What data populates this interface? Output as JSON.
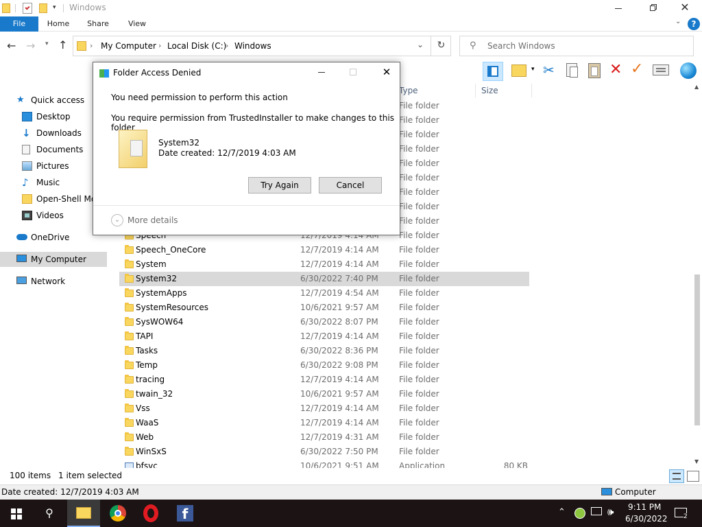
{
  "window": {
    "title": "Windows"
  },
  "ribbon": {
    "tabs": [
      "File",
      "Home",
      "Share",
      "View"
    ],
    "help": "?"
  },
  "address": {
    "crumbs": [
      "My Computer",
      "Local Disk (C:)",
      "Windows"
    ],
    "search_placeholder": "Search Windows"
  },
  "nav": {
    "items": [
      {
        "label": "Quick access",
        "icon": "star-icon",
        "top": true
      },
      {
        "label": "Desktop",
        "icon": "desktop-icon"
      },
      {
        "label": "Downloads",
        "icon": "download-icon"
      },
      {
        "label": "Documents",
        "icon": "documents-icon"
      },
      {
        "label": "Pictures",
        "icon": "pictures-icon"
      },
      {
        "label": "Music",
        "icon": "music-icon"
      },
      {
        "label": "Open-Shell Mo",
        "icon": "folder-icon"
      },
      {
        "label": "Videos",
        "icon": "videos-icon"
      },
      {
        "label": "OneDrive",
        "icon": "cloud-icon",
        "top": true
      },
      {
        "label": "My Computer",
        "icon": "computer-icon",
        "top": true,
        "selected": true
      },
      {
        "label": "Network",
        "icon": "network-icon",
        "top": true
      }
    ]
  },
  "columns": {
    "type": "Type",
    "size": "Size"
  },
  "files": [
    {
      "name": "",
      "date": "",
      "type": "File folder",
      "size": ""
    },
    {
      "name": "",
      "date": "",
      "type": "File folder",
      "size": ""
    },
    {
      "name": "",
      "date": "",
      "type": "File folder",
      "size": ""
    },
    {
      "name": "",
      "date": "",
      "type": "File folder",
      "size": ""
    },
    {
      "name": "",
      "date": "",
      "type": "File folder",
      "size": ""
    },
    {
      "name": "",
      "date": "",
      "type": "File folder",
      "size": ""
    },
    {
      "name": "",
      "date": "",
      "type": "File folder",
      "size": ""
    },
    {
      "name": "",
      "date": "",
      "type": "File folder",
      "size": ""
    },
    {
      "name": "",
      "date": "",
      "type": "File folder",
      "size": ""
    },
    {
      "name": "Speech",
      "date": "12/7/2019 4:14 AM",
      "type": "File folder",
      "size": ""
    },
    {
      "name": "Speech_OneCore",
      "date": "12/7/2019 4:14 AM",
      "type": "File folder",
      "size": ""
    },
    {
      "name": "System",
      "date": "12/7/2019 4:14 AM",
      "type": "File folder",
      "size": ""
    },
    {
      "name": "System32",
      "date": "6/30/2022 7:40 PM",
      "type": "File folder",
      "size": "",
      "selected": true
    },
    {
      "name": "SystemApps",
      "date": "12/7/2019 4:54 AM",
      "type": "File folder",
      "size": ""
    },
    {
      "name": "SystemResources",
      "date": "10/6/2021 9:57 AM",
      "type": "File folder",
      "size": ""
    },
    {
      "name": "SysWOW64",
      "date": "6/30/2022 8:07 PM",
      "type": "File folder",
      "size": ""
    },
    {
      "name": "TAPI",
      "date": "12/7/2019 4:14 AM",
      "type": "File folder",
      "size": ""
    },
    {
      "name": "Tasks",
      "date": "6/30/2022 8:36 PM",
      "type": "File folder",
      "size": ""
    },
    {
      "name": "Temp",
      "date": "6/30/2022 9:08 PM",
      "type": "File folder",
      "size": ""
    },
    {
      "name": "tracing",
      "date": "12/7/2019 4:14 AM",
      "type": "File folder",
      "size": ""
    },
    {
      "name": "twain_32",
      "date": "10/6/2021 9:57 AM",
      "type": "File folder",
      "size": ""
    },
    {
      "name": "Vss",
      "date": "12/7/2019 4:14 AM",
      "type": "File folder",
      "size": ""
    },
    {
      "name": "WaaS",
      "date": "12/7/2019 4:14 AM",
      "type": "File folder",
      "size": ""
    },
    {
      "name": "Web",
      "date": "12/7/2019 4:31 AM",
      "type": "File folder",
      "size": ""
    },
    {
      "name": "WinSxS",
      "date": "6/30/2022 7:50 PM",
      "type": "File folder",
      "size": ""
    },
    {
      "name": "bfsvc",
      "date": "10/6/2021 9:51 AM",
      "type": "Application",
      "size": "80 KB"
    }
  ],
  "status": {
    "items": "100 items",
    "selected": "1 item selected"
  },
  "info": {
    "left": "Date created: 12/7/2019 4:03 AM",
    "right": "Computer"
  },
  "dialog": {
    "title": "Folder Access Denied",
    "line1": "You need permission to perform this action",
    "line2": "You require permission from TrustedInstaller to make changes to this folder",
    "item_name": "System32",
    "item_date": "Date created: 12/7/2019 4:03 AM",
    "try_again": "Try Again",
    "cancel": "Cancel",
    "more_details": "More details"
  },
  "tray": {
    "time": "9:11 PM",
    "date": "6/30/2022",
    "notif_count": "2"
  },
  "colors": {
    "accent": "#0c7dbf",
    "file_tab": "#1979ca",
    "selected_row": "#d9d9d9",
    "taskbar": "#1c1414"
  }
}
